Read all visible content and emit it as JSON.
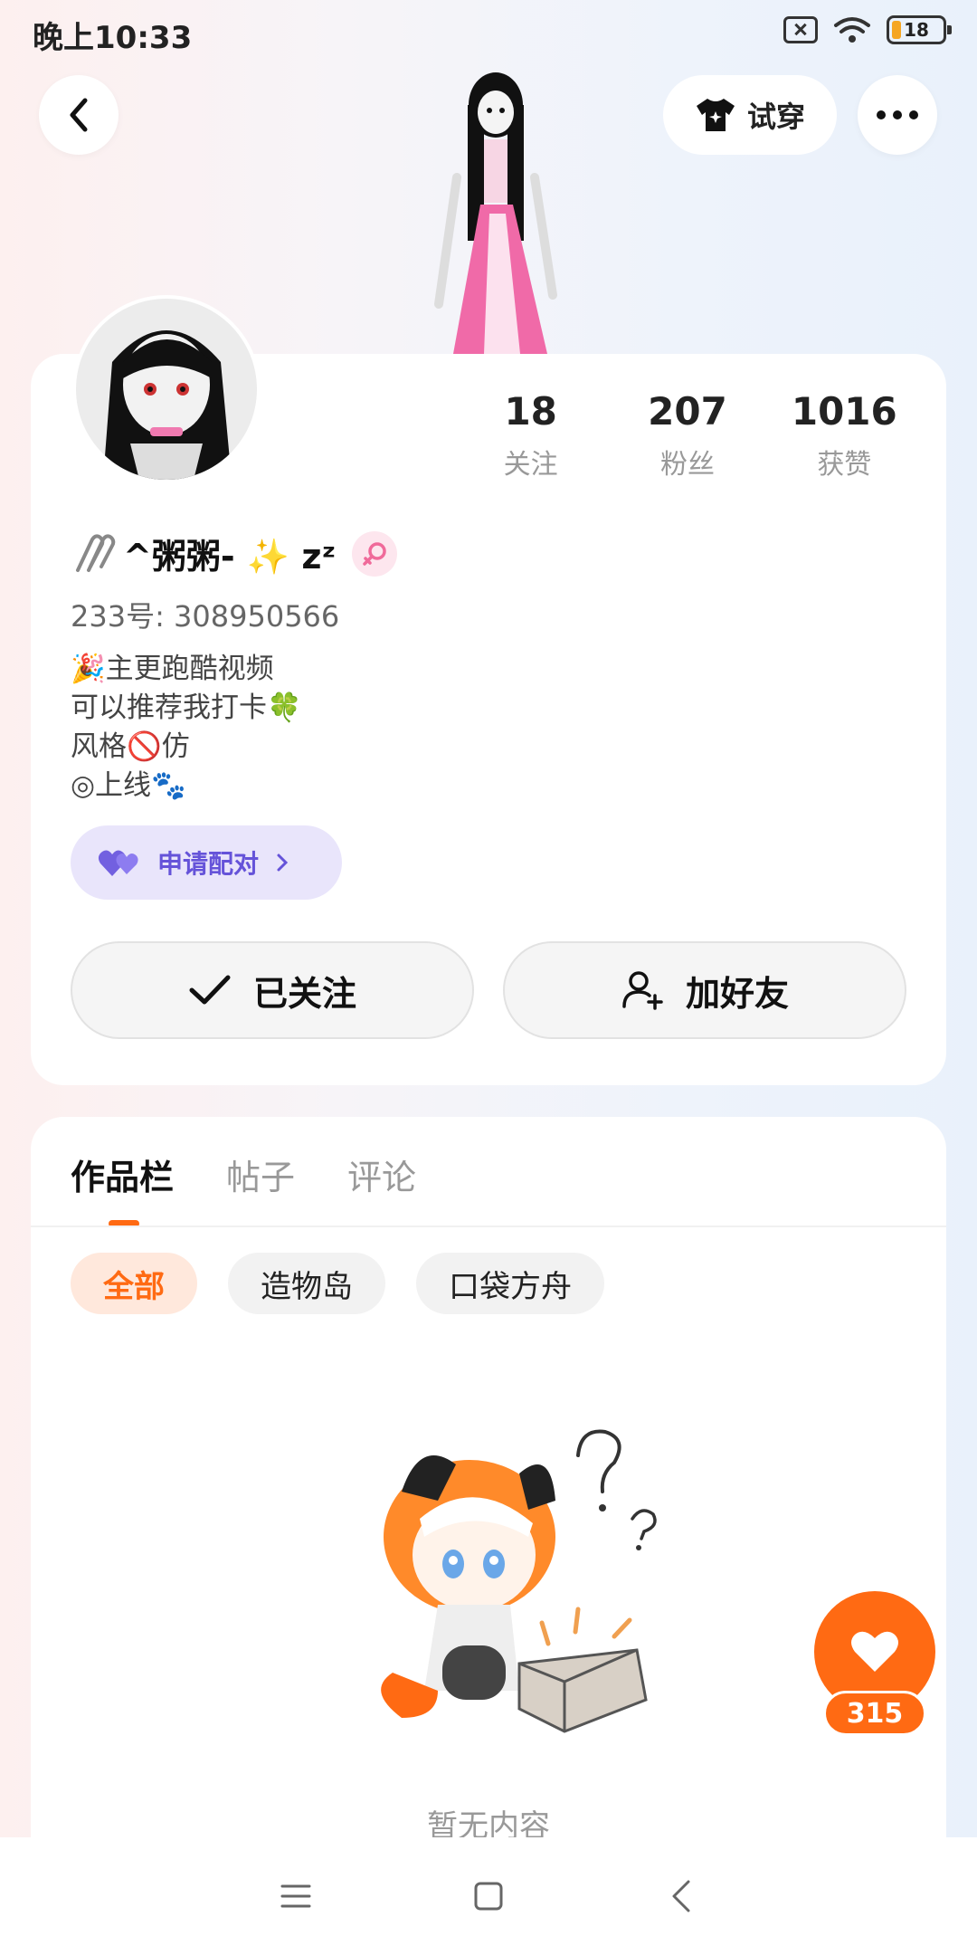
{
  "status": {
    "time": "晚上10:33",
    "battery": "18"
  },
  "header": {
    "try_on_label": "试穿"
  },
  "profile": {
    "name": "^粥粥- ✨ zᶻ",
    "uid": "233号: 308950566",
    "stats": [
      {
        "value": "18",
        "label": "关注"
      },
      {
        "value": "207",
        "label": "粉丝"
      },
      {
        "value": "1016",
        "label": "获赞"
      }
    ],
    "bio": [
      "🎉主更跑酷视频",
      "可以推荐我打卡🍀",
      "风格🚫仿",
      "◎上线🐾"
    ],
    "pair_label": "申请配对",
    "follow_label": "已关注",
    "add_friend_label": "加好友"
  },
  "works": {
    "tabs": [
      "作品栏",
      "帖子",
      "评论"
    ],
    "chips": [
      "全部",
      "造物岛",
      "口袋方舟"
    ],
    "empty_text": "暂无内容"
  },
  "like": {
    "count": "315"
  },
  "colors": {
    "accent": "#ff6a13",
    "pair": "#6553d9"
  }
}
